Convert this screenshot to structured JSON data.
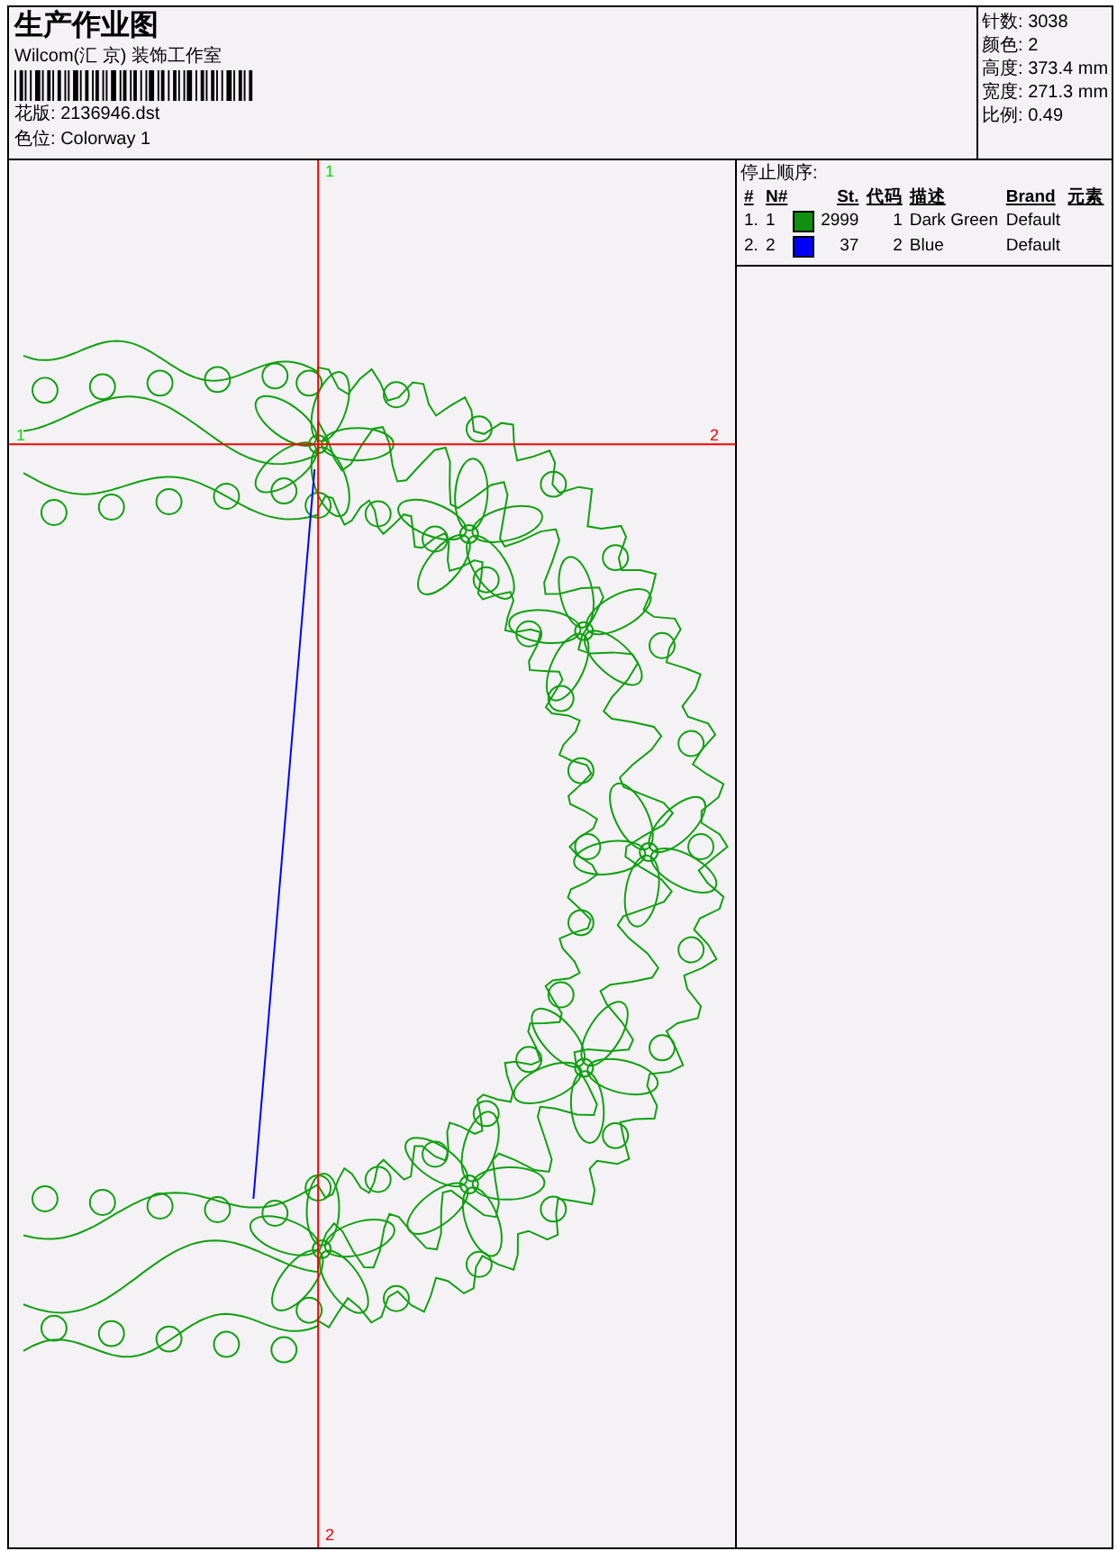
{
  "header": {
    "title": "生产作业图",
    "company": "Wilcom(汇 京) 装饰工作室",
    "fields": [
      {
        "label": "花版:",
        "value": "2136946.dst"
      },
      {
        "label": "色位:",
        "value": "Colorway 1"
      }
    ]
  },
  "stats": [
    {
      "label": "针数:",
      "value": "3038"
    },
    {
      "label": "颜色:",
      "value": "2"
    },
    {
      "label": "高度:",
      "value": "373.4 mm"
    },
    {
      "label": "宽度:",
      "value": "271.3 mm"
    },
    {
      "label": "比例:",
      "value": "0.49"
    }
  ],
  "canvas": {
    "markers": [
      {
        "start_label": "1",
        "end_label": "2"
      },
      {
        "start_label": "1",
        "end_label": "2"
      }
    ]
  },
  "stop_sequence": {
    "title": "停止顺序:",
    "columns": [
      "#",
      "N#",
      "St.",
      "代码",
      "描述",
      "Brand",
      "元素"
    ],
    "rows": [
      {
        "index": "1.",
        "number": "1",
        "color": "#109010",
        "stitches": "2999",
        "code": "1",
        "description": "Dark Green",
        "brand": "Default"
      },
      {
        "index": "2.",
        "number": "2",
        "color": "#0000ff",
        "stitches": "37",
        "code": "2",
        "description": "Blue",
        "brand": "Default"
      }
    ]
  }
}
